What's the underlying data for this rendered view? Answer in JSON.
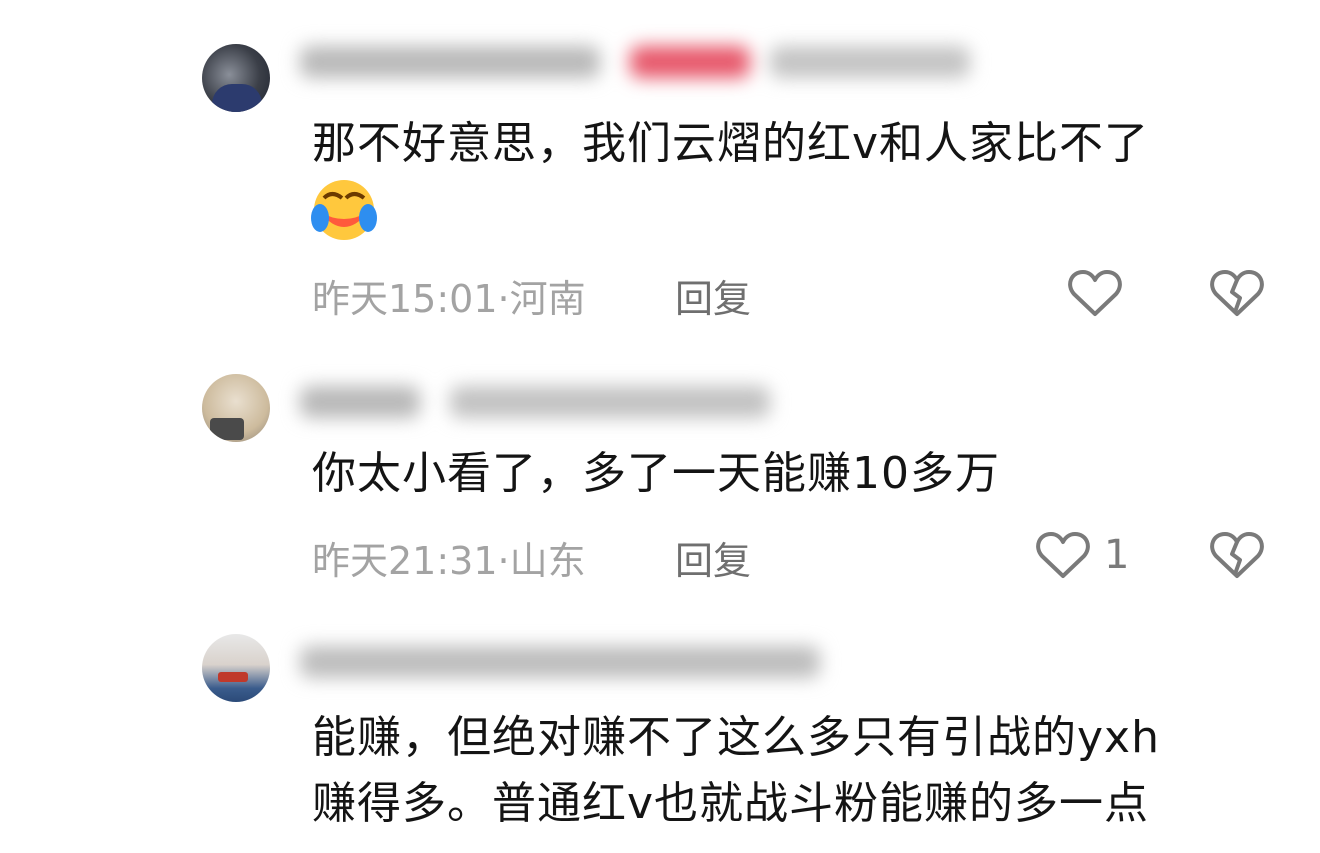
{
  "comments": [
    {
      "text": "那不好意思，我们云熠的红v和人家比不了",
      "time_location": "昨天15:01·河南",
      "reply_label": "回复",
      "like_count": "",
      "has_emoji": "face-with-tears-of-joy"
    },
    {
      "text": "你太小看了，多了一天能赚10多万",
      "time_location": "昨天21:31·山东",
      "reply_label": "回复",
      "like_count": "1"
    },
    {
      "text_line1": "能赚，但绝对赚不了这么多只有引战的yxh",
      "text_line2": "赚得多。普通红v也就战斗粉能赚的多一点"
    }
  ],
  "icons": {
    "like": "heart-outline-icon",
    "dislike": "broken-heart-icon",
    "emoji": "face-with-tears-of-joy-icon"
  },
  "colors": {
    "text": "#141414",
    "meta": "#a3a3a3",
    "reply": "#6f6f6f",
    "icon": "#7a7a7a"
  }
}
